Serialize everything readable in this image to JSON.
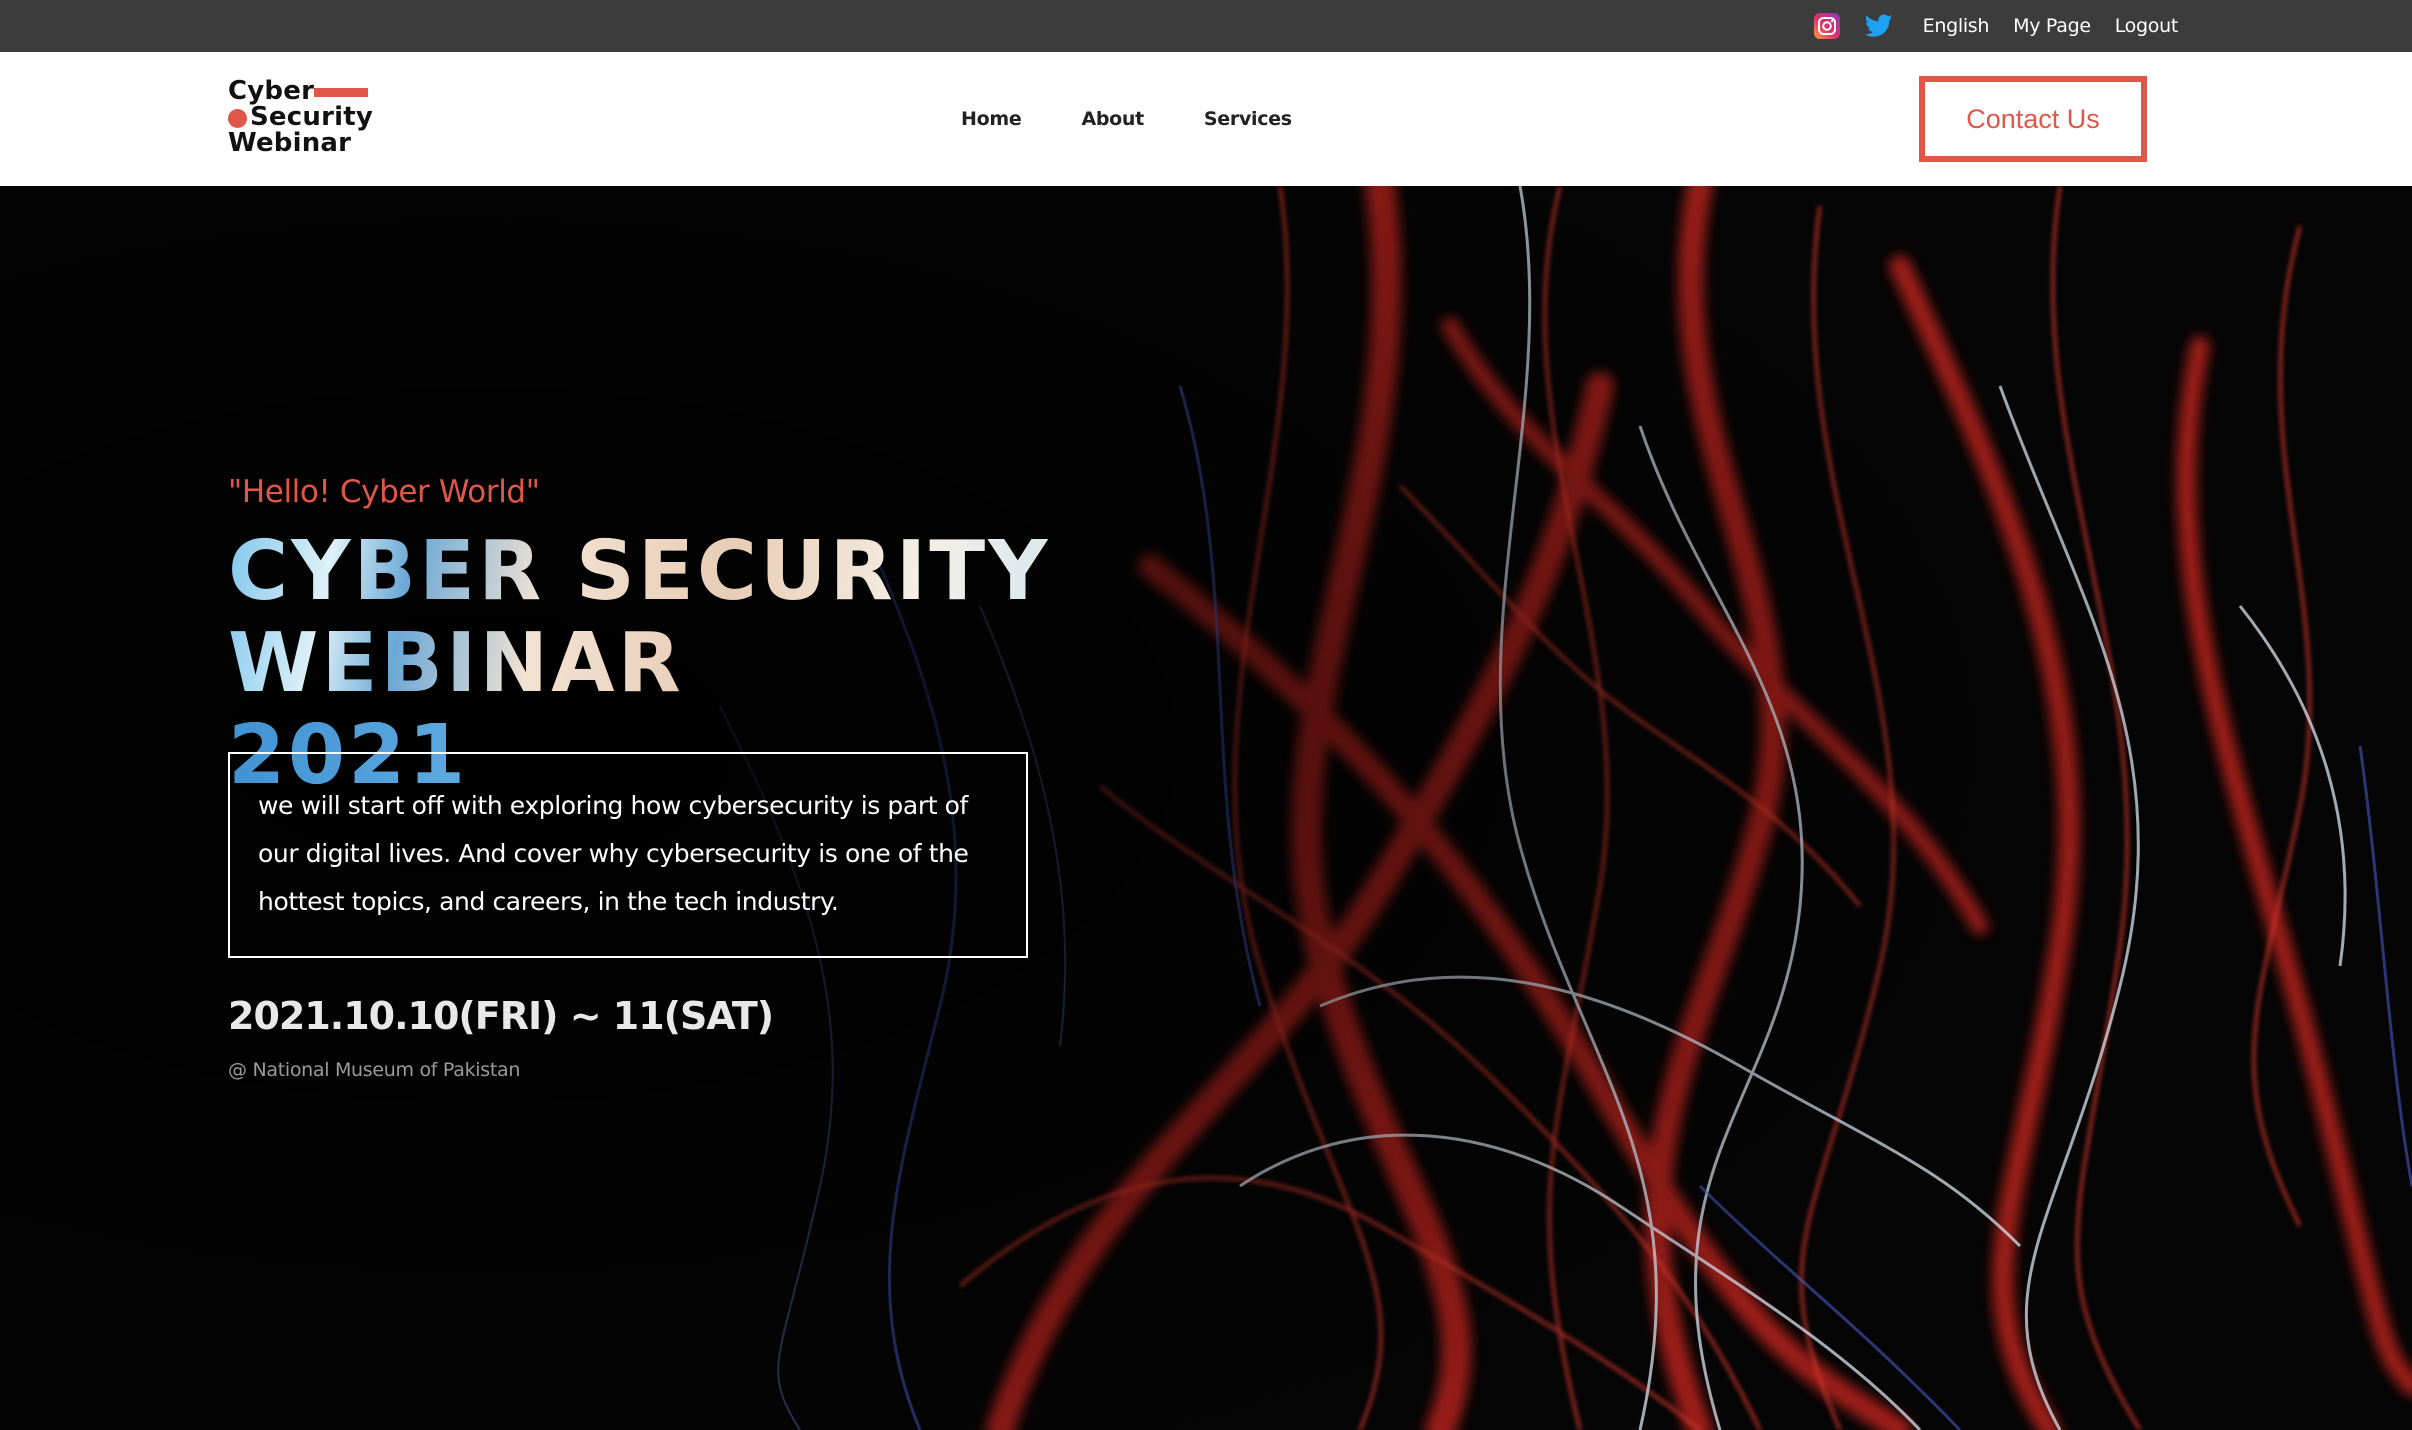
{
  "topbar": {
    "icons": [
      "instagram-icon",
      "twitter-icon"
    ],
    "links": [
      "English",
      "My Page",
      "Logout"
    ]
  },
  "header": {
    "logo": {
      "line1": "Cyber",
      "line2": "Security",
      "line3": "Webinar"
    },
    "nav": [
      "Home",
      "About",
      "Services"
    ],
    "contact_label": "Contact Us"
  },
  "hero": {
    "tagline": "\"Hello! Cyber World\"",
    "title_line1": "CYBER SECURITY WEBINAR",
    "title_line2": "2021",
    "description": "we will start off with exploring how cybersecurity is part of our digital lives. And cover why cybersecurity is one of the hottest topics, and careers, in the tech industry.",
    "date": "2021.10.10(FRI) ~ 11(SAT)",
    "venue": "@ National Museum of Pakistan"
  },
  "colors": {
    "accent": "#e0574a",
    "topbar_bg": "#3c3c3c",
    "header_bg": "#ffffff",
    "hero_bg": "#050505",
    "twitter": "#1da1f2"
  }
}
